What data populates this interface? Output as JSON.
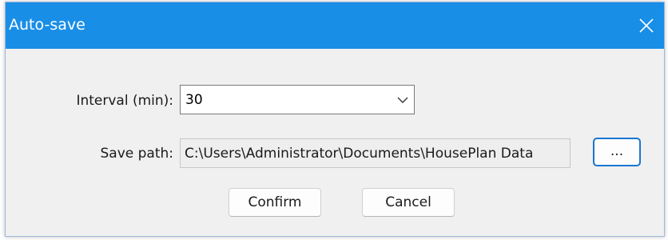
{
  "window": {
    "title": "Auto-save"
  },
  "interval": {
    "label": "Interval (min):",
    "value": "30"
  },
  "save_path": {
    "label": "Save path:",
    "value": "C:\\Users\\Administrator\\Documents\\HousePlan Data",
    "browse_label": "..."
  },
  "buttons": {
    "confirm": "Confirm",
    "cancel": "Cancel"
  },
  "icons": {
    "close": "close-icon",
    "dropdown": "chevron-down-icon"
  },
  "colors": {
    "titlebar": "#198ee7",
    "accent_border": "#1a76d2"
  }
}
